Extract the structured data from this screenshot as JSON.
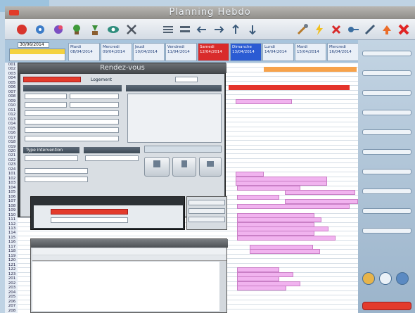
{
  "app": {
    "title": "Planning Hebdo"
  },
  "brand": {
    "logo_text": ""
  },
  "datebar": {
    "start_date": "30/06/2014",
    "today_label": ""
  },
  "days": [
    {
      "label": "Mardi",
      "date": "08/04/2014",
      "color": "#e9eff7"
    },
    {
      "label": "Mercredi",
      "date": "09/04/2014",
      "color": "#e9eff7"
    },
    {
      "label": "Jeudi",
      "date": "10/04/2014",
      "color": "#e9eff7"
    },
    {
      "label": "Vendredi",
      "date": "11/04/2014",
      "color": "#e9eff7"
    },
    {
      "label": "Samedi",
      "date": "12/04/2014",
      "color": "#d92b2b"
    },
    {
      "label": "Dimanche",
      "date": "13/04/2014",
      "color": "#2b5bd3"
    },
    {
      "label": "Lundi",
      "date": "14/04/2014",
      "color": "#e9eff7"
    },
    {
      "label": "Mardi",
      "date": "15/04/2014",
      "color": "#e9eff7"
    },
    {
      "label": "Mercredi",
      "date": "16/04/2014",
      "color": "#e9eff7"
    }
  ],
  "rows": [
    "001",
    "002",
    "003",
    "004",
    "005",
    "006",
    "007",
    "008",
    "009",
    "010",
    "011",
    "012",
    "013",
    "014",
    "015",
    "016",
    "017",
    "018",
    "019",
    "020",
    "021",
    "022",
    "023",
    "024",
    "101",
    "102",
    "103",
    "104",
    "105",
    "106",
    "107",
    "108",
    "109",
    "110",
    "111",
    "112",
    "113",
    "114",
    "115",
    "116",
    "117",
    "118",
    "119",
    "120",
    "121",
    "122",
    "123",
    "201",
    "202",
    "203",
    "204",
    "205",
    "206",
    "207",
    "208"
  ],
  "dialog": {
    "title": "Rendez-vous",
    "client_code": "",
    "logement_label": "Logement",
    "section_rdv": "",
    "section_facture": "",
    "section_info": "Type intervention",
    "section_info2": "",
    "btn_facturer": "",
    "btn_reglement": "",
    "btn_fermer": "",
    "btn_envoyer": "",
    "btn_remise": "",
    "btn_detail": "",
    "btn_fiche": "",
    "client_name": ""
  },
  "dialog2": {
    "title": "",
    "tabs": [
      "",
      "",
      "",
      ""
    ],
    "columns": [
      "",
      "",
      "",
      "",
      "",
      "",
      ""
    ]
  },
  "right_panel": {
    "labels": [
      "",
      "",
      "",
      "",
      "",
      "",
      "",
      "",
      "",
      ""
    ],
    "close_button": ""
  },
  "bookings": [
    {
      "text": "",
      "color": "orange"
    },
    {
      "text": "",
      "color": "red"
    },
    {
      "text": "",
      "color": "pink"
    },
    {
      "text": "",
      "color": "pink"
    },
    {
      "text": "",
      "color": "pink"
    },
    {
      "text": "",
      "color": "pink"
    },
    {
      "text": "",
      "color": "pink"
    },
    {
      "text": "",
      "color": "pink"
    },
    {
      "text": "",
      "color": "pink"
    },
    {
      "text": "",
      "color": "pink"
    },
    {
      "text": "",
      "color": "pink"
    },
    {
      "text": "",
      "color": "pink"
    },
    {
      "text": "",
      "color": "pink"
    },
    {
      "text": "",
      "color": "pink"
    },
    {
      "text": "",
      "color": "pink"
    },
    {
      "text": "",
      "color": "pink"
    },
    {
      "text": "",
      "color": "pink"
    },
    {
      "text": "",
      "color": "pink"
    },
    {
      "text": "",
      "color": "pink"
    },
    {
      "text": "",
      "color": "pink"
    },
    {
      "text": "",
      "color": "pink"
    },
    {
      "text": "",
      "color": "pink"
    },
    {
      "text": "",
      "color": "pink"
    },
    {
      "text": "",
      "color": "pink"
    }
  ]
}
